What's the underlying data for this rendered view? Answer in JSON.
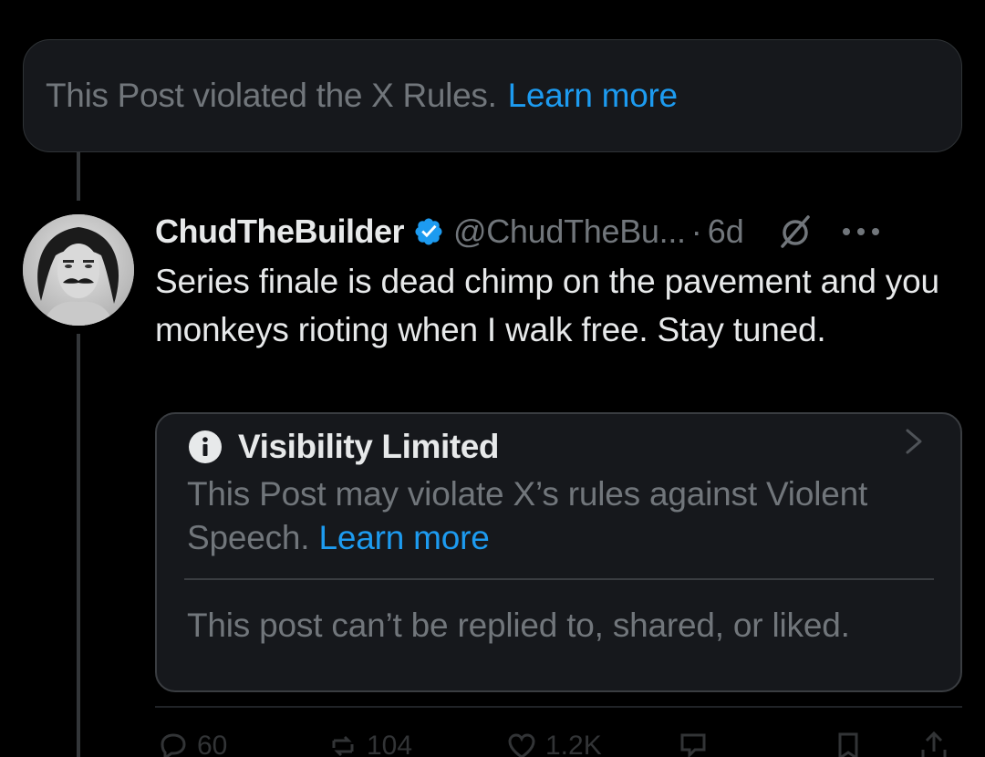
{
  "banner": {
    "text": "This Post violated the X Rules.",
    "link": "Learn more"
  },
  "post": {
    "display_name": "ChudTheBuilder",
    "handle": "@ChudTheBu...",
    "separator": "·",
    "time": "6d",
    "text": "Series finale is dead chimp on the pavement and you monkeys rioting when I walk free. Stay tuned."
  },
  "visibility": {
    "title": "Visibility Limited",
    "body": "This Post may violate X’s rules against Violent Speech.",
    "link": "Learn more",
    "note": "This post can’t be replied to, shared, or liked."
  },
  "actions": {
    "replies": "60",
    "reposts": "104",
    "likes": "1.2K"
  },
  "icons": [
    "verified-badge-icon",
    "grok-icon",
    "more-icon",
    "info-icon",
    "chevron-right-icon",
    "reply-icon",
    "repost-icon",
    "like-icon",
    "views-icon",
    "bookmark-icon",
    "share-icon"
  ],
  "colors": {
    "background": "#000000",
    "link": "#1d9bf0",
    "muted": "#71767b",
    "text": "#e7e9ea",
    "card": "#16181c"
  }
}
